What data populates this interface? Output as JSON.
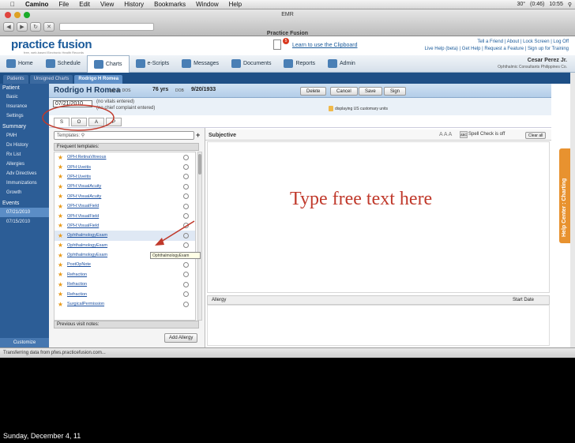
{
  "menubar": {
    "app_name": "Camino",
    "items": [
      "File",
      "Edit",
      "View",
      "History",
      "Bookmarks",
      "Window",
      "Help"
    ],
    "clock": "10:55",
    "battery": "(0:46)",
    "temp": "30°"
  },
  "window": {
    "title": "EMR",
    "page_title": "Practice Fusion"
  },
  "header": {
    "logo": "practice fusion",
    "tagline": "free, web-based Electronic Health Records",
    "clipboard_link": "Learn to use the Clipboard",
    "clipboard_badge": "5",
    "top_links_1": "Tell a Friend | About | Lock Screen | Log Off",
    "top_links_2": "Live Help (beta) | Get Help | Request a Feature | Sign up for Training"
  },
  "nav": {
    "items": [
      {
        "label": "Home",
        "icon": "home-icon"
      },
      {
        "label": "Schedule",
        "icon": "calendar-icon"
      },
      {
        "label": "Charts",
        "icon": "folder-icon"
      },
      {
        "label": "e-Scripts",
        "icon": "rx-icon"
      },
      {
        "label": "Messages",
        "icon": "envelope-icon"
      },
      {
        "label": "Documents",
        "icon": "documents-icon"
      },
      {
        "label": "Reports",
        "icon": "percent-icon"
      },
      {
        "label": "Admin",
        "icon": "wrench-icon"
      }
    ],
    "active": "Charts",
    "user_name": "Cesar Perez Jr.",
    "user_org": "Ophthalmic Consultants Philippines Co."
  },
  "subtabs": [
    "Patients",
    "Unsigned Charts",
    "Rodrigo H Romea"
  ],
  "sidebar": {
    "patient_header": "Patient",
    "patient_items": [
      "Basic",
      "Insurance",
      "Settings"
    ],
    "summary_header": "Summary",
    "summary_items": [
      "PMH",
      "Dx History",
      "Rx List",
      "Allergies",
      "Adv Directives",
      "Immunizations",
      "Growth"
    ],
    "events_header": "Events",
    "events_items": [
      "07/21/2010",
      "07/15/2010"
    ],
    "customize": "Customize"
  },
  "patient": {
    "name": "Rodrigo H Romea",
    "age_label": "age on DOS",
    "age": "76 yrs",
    "dob_label": "DOB",
    "dob": "9/20/1933",
    "buttons": [
      "Delete",
      "Cancel",
      "Save",
      "Sign"
    ]
  },
  "encounter": {
    "date": "07/21/2010",
    "vitals": "(no vitals entered)",
    "complaint": "(no chief complaint entered)",
    "units": "displaying US customary units"
  },
  "soap_tabs": [
    "S",
    "O",
    "A",
    "P"
  ],
  "templates": {
    "search_placeholder": "Templates:",
    "frequent_label": "Frequent templates:",
    "items": [
      "OPH:RetinaVitreous",
      "OPH:Uveitis",
      "OPH:Uveitis",
      "OPH:VisualAcuity",
      "OPH:VisualAcuity",
      "OPH:VisualField",
      "OPH:VisualField",
      "OPH:VisualField",
      "OphthalmologyExam",
      "OphthalmologyExam",
      "OphthalmologyExam",
      "PostOpNote",
      "Refraction",
      "Refraction",
      "Refraction",
      "SurgicalPermission"
    ],
    "tooltip": "OphthalmologyExam",
    "previous_notes": "Previous visit notes:",
    "add_allergy": "Add Allergy"
  },
  "subjective": {
    "label": "Subjective",
    "font_sizes": "A A A",
    "spell_icon": "ABC",
    "spell": "Spell Check is off",
    "clear_all": "Clear all",
    "annotation": "Type free text here"
  },
  "allergy": {
    "label": "Allergy",
    "start_date": "Start Date"
  },
  "help_center": "Help Center : Charting",
  "status": "Transferring data from pfws.practicefusion.com...",
  "caption": "Sunday, December 4, 11",
  "colors": {
    "accent": "#1e4f86",
    "annotation": "#c0392b",
    "sidebar": "#2c5d96"
  }
}
